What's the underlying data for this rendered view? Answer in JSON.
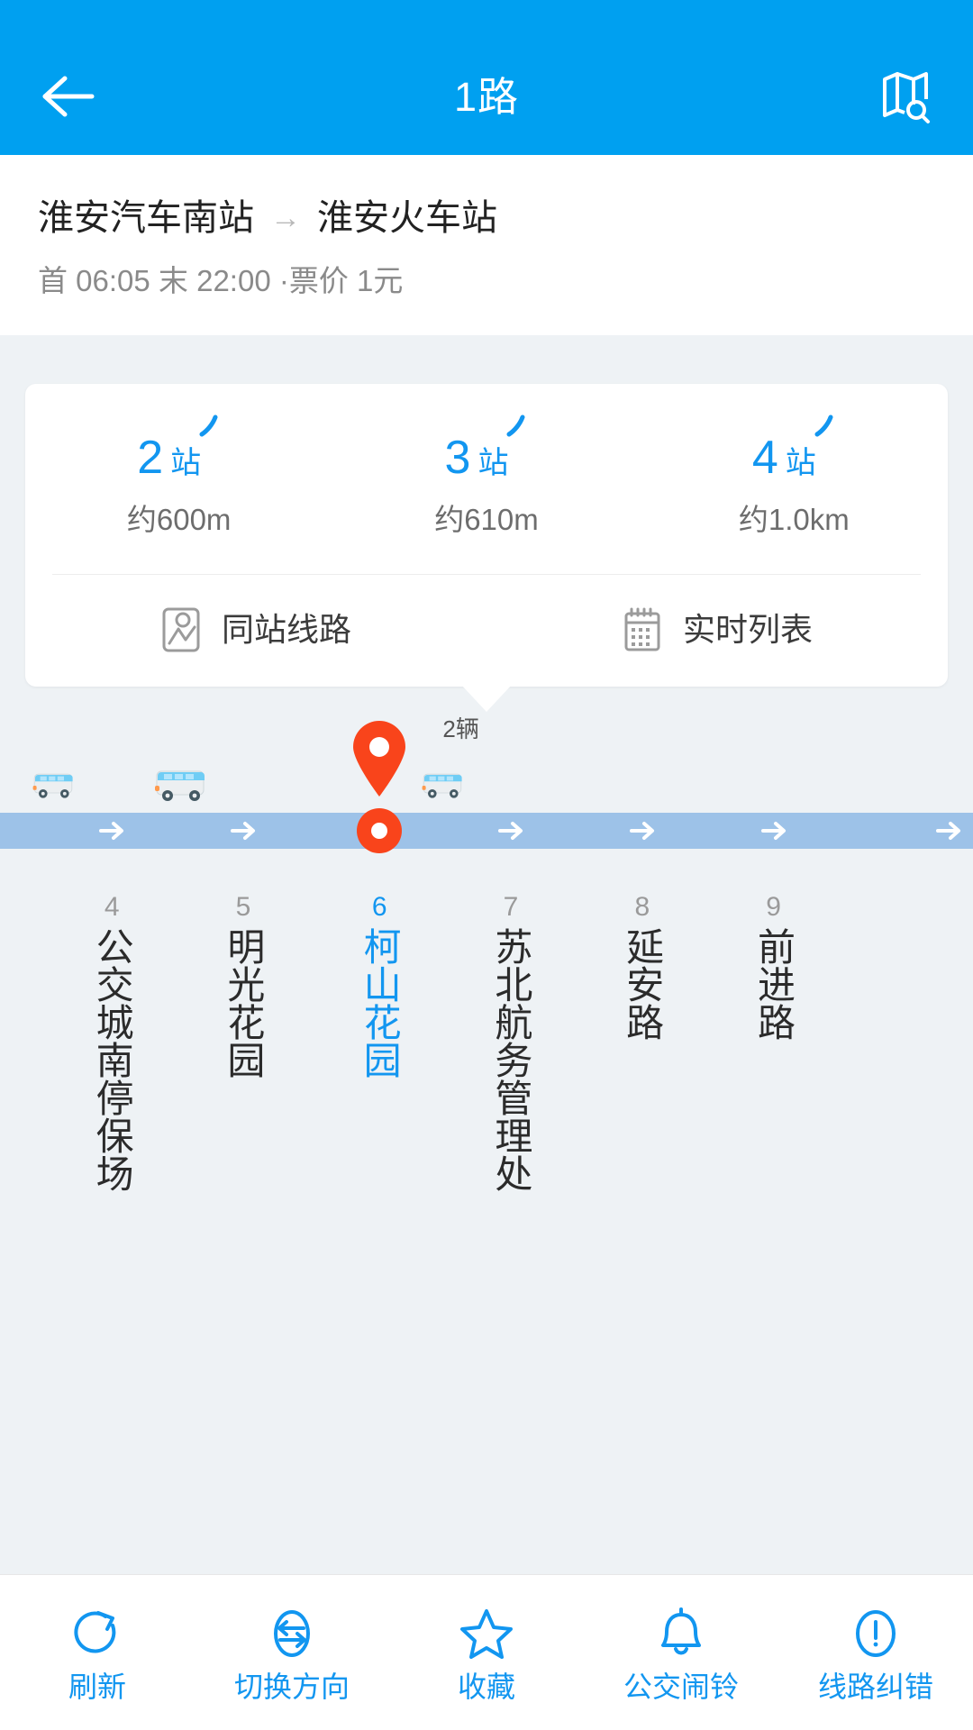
{
  "theme": {
    "header_bg": "#00A0F0",
    "accent": "#1296f0",
    "page_bg": "#eef2f5",
    "lane_bg": "#9dc2e8",
    "marker_red": "#f9441b"
  },
  "header": {
    "title": "1路",
    "back_icon": "back-arrow-icon",
    "map_icon": "map-search-icon"
  },
  "route": {
    "origin": "淮安汽车南站",
    "arrow": "→",
    "destination": "淮安火车站",
    "schedule": "首 06:05 末 22:00 ·票价 1元"
  },
  "card": {
    "stats": [
      {
        "count": "2",
        "unit": "站",
        "distance": "约600m"
      },
      {
        "count": "3",
        "unit": "站",
        "distance": "约610m"
      },
      {
        "count": "4",
        "unit": "站",
        "distance": "约1.0km"
      }
    ],
    "actions": [
      {
        "label": "同站线路",
        "icon": "map-pin-route-icon"
      },
      {
        "label": "实时列表",
        "icon": "realtime-list-icon"
      }
    ]
  },
  "lane": {
    "bus_count_label": "2辆",
    "buses": [
      {
        "left_pct": 5.5,
        "scale": 0.8
      },
      {
        "left_pct": 18.5,
        "scale": 1.0
      },
      {
        "left_pct": 45.5,
        "scale": 0.8
      }
    ],
    "arrows_pct": [
      11.5,
      25.0,
      52.5,
      66.0,
      79.5,
      93.0
    ],
    "pin_pct": 39.0,
    "bus_count_pct": 45.5
  },
  "stations": [
    {
      "num": "4",
      "name": "公交城南停保场",
      "pct": 11.5,
      "active": false
    },
    {
      "num": "5",
      "name": "明光花园",
      "pct": 25.0,
      "active": false
    },
    {
      "num": "6",
      "name": "柯山花园",
      "pct": 39.0,
      "active": true
    },
    {
      "num": "7",
      "name": "苏北航务管理处",
      "pct": 52.5,
      "active": false
    },
    {
      "num": "8",
      "name": "延安路",
      "pct": 66.0,
      "active": false
    },
    {
      "num": "9",
      "name": "前进路",
      "pct": 79.5,
      "active": false
    }
  ],
  "bottom_bar": [
    {
      "label": "刷新",
      "icon": "refresh-icon"
    },
    {
      "label": "切换方向",
      "icon": "swap-direction-icon"
    },
    {
      "label": "收藏",
      "icon": "star-icon"
    },
    {
      "label": "公交闹铃",
      "icon": "bell-icon"
    },
    {
      "label": "线路纠错",
      "icon": "report-error-icon"
    }
  ]
}
